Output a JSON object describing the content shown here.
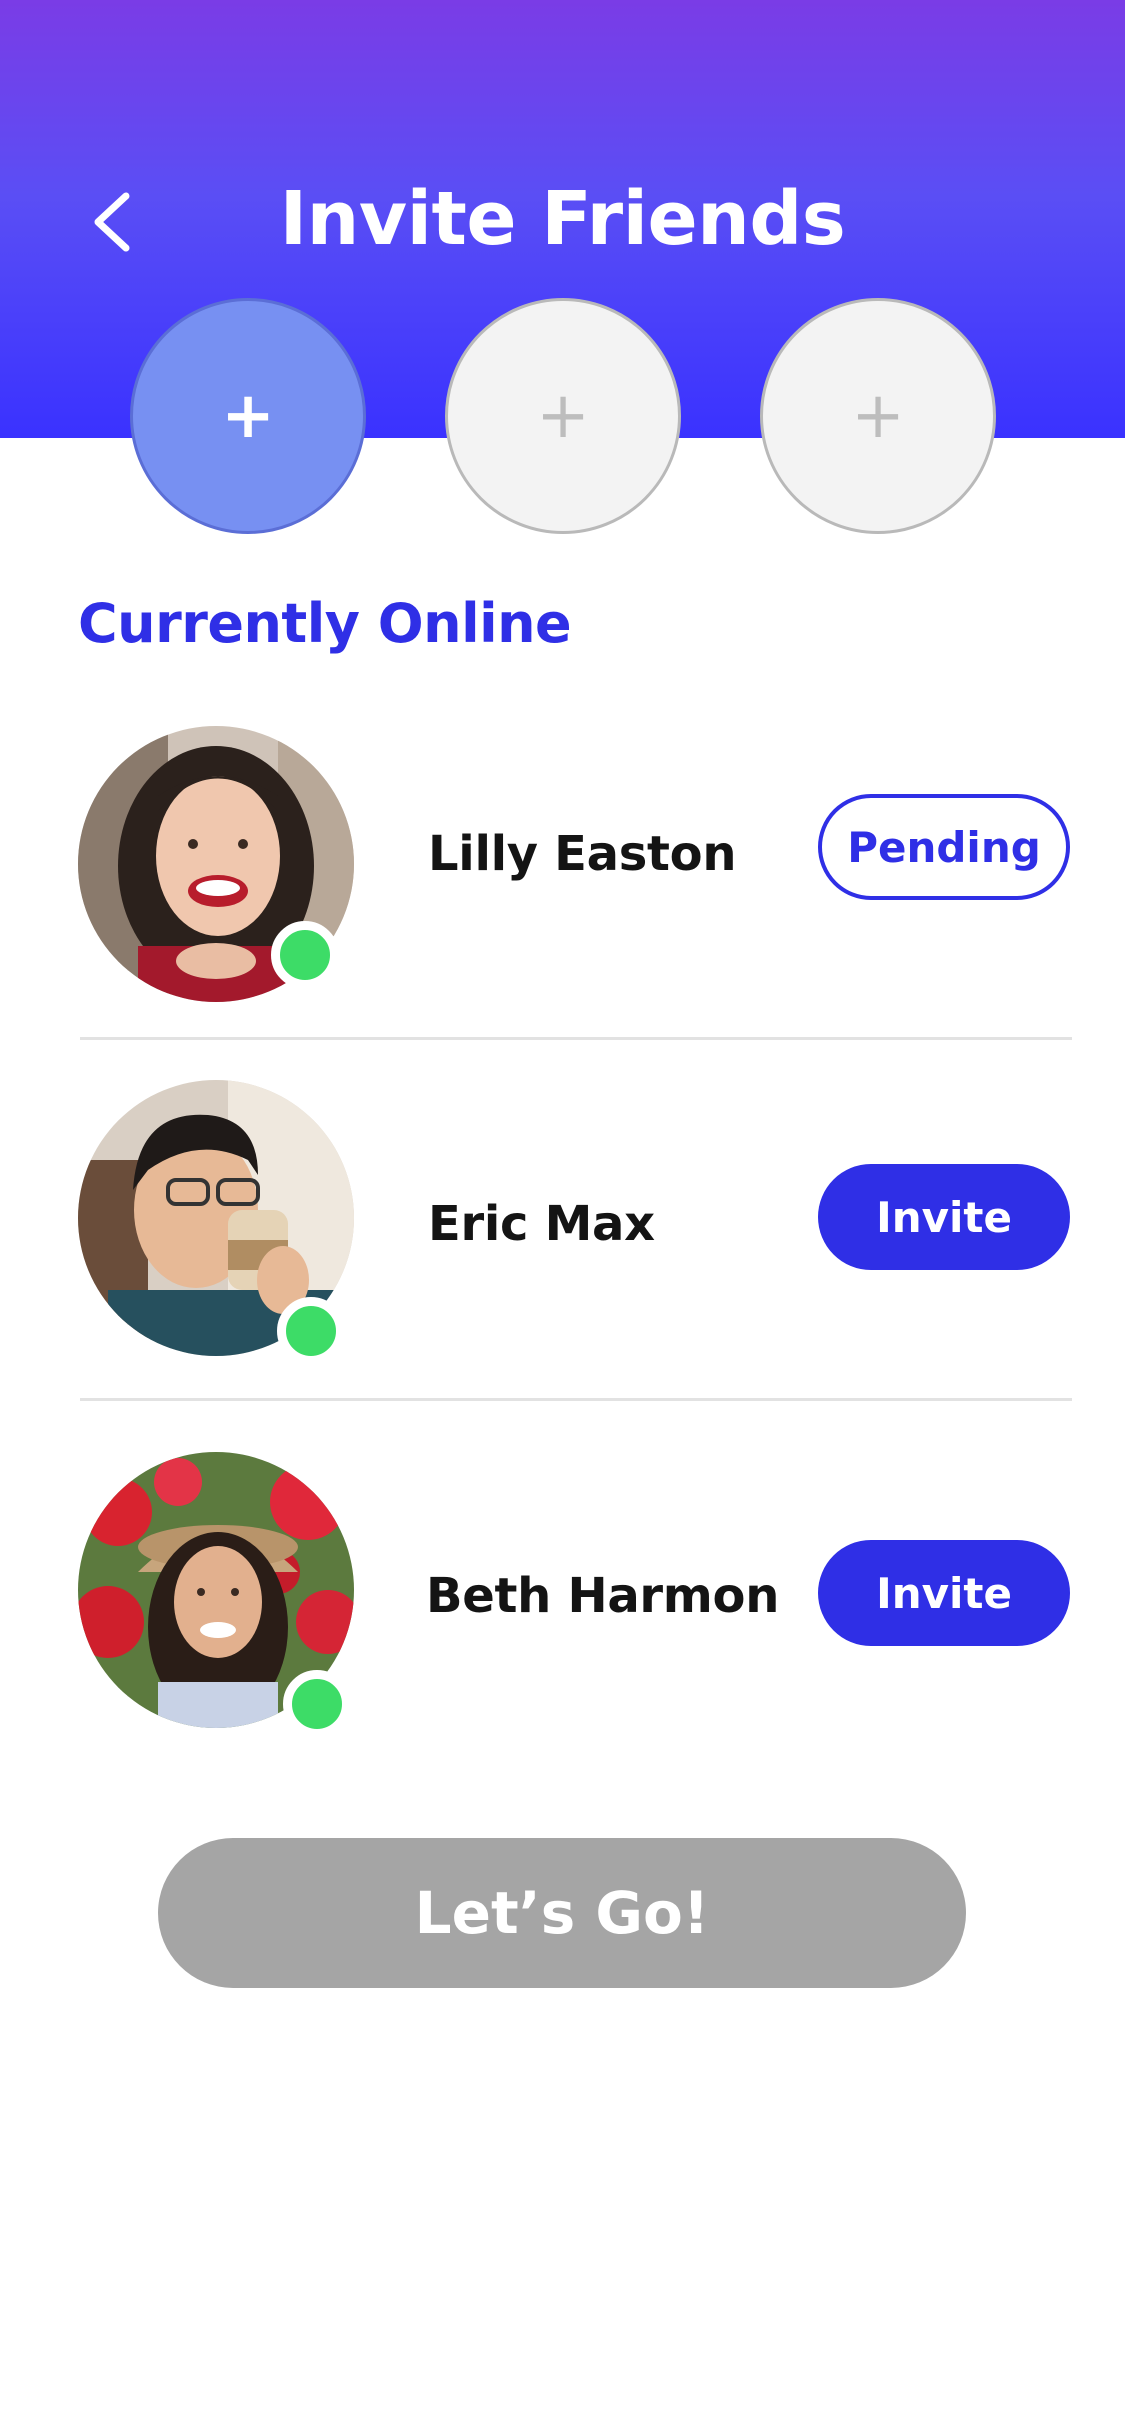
{
  "header": {
    "title": "Invite Friends",
    "back_icon": "chevron-left-icon",
    "gradient_colors": [
      "#7a3ce6",
      "#3a32ff"
    ]
  },
  "invite_slots": [
    {
      "icon": "plus-icon",
      "label": "+",
      "state": "active"
    },
    {
      "icon": "plus-icon",
      "label": "+",
      "state": "empty"
    },
    {
      "icon": "plus-icon",
      "label": "+",
      "state": "empty"
    }
  ],
  "section": {
    "title": "Currently Online"
  },
  "friends": [
    {
      "name": "Lilly Easton",
      "action": "Pending",
      "action_style": "outline",
      "online": true
    },
    {
      "name": "Eric Max",
      "action": "Invite",
      "action_style": "filled",
      "online": true
    },
    {
      "name": "Beth Harmon",
      "action": "Invite",
      "action_style": "filled",
      "online": true
    }
  ],
  "footer": {
    "go_label": "Let’s Go!",
    "go_state": "disabled"
  },
  "colors": {
    "accent": "#2f2fe6",
    "online": "#3ddc67",
    "disabled": "#a5a5a5",
    "slot_active": "#7790f2",
    "slot_empty": "#f3f3f3"
  }
}
